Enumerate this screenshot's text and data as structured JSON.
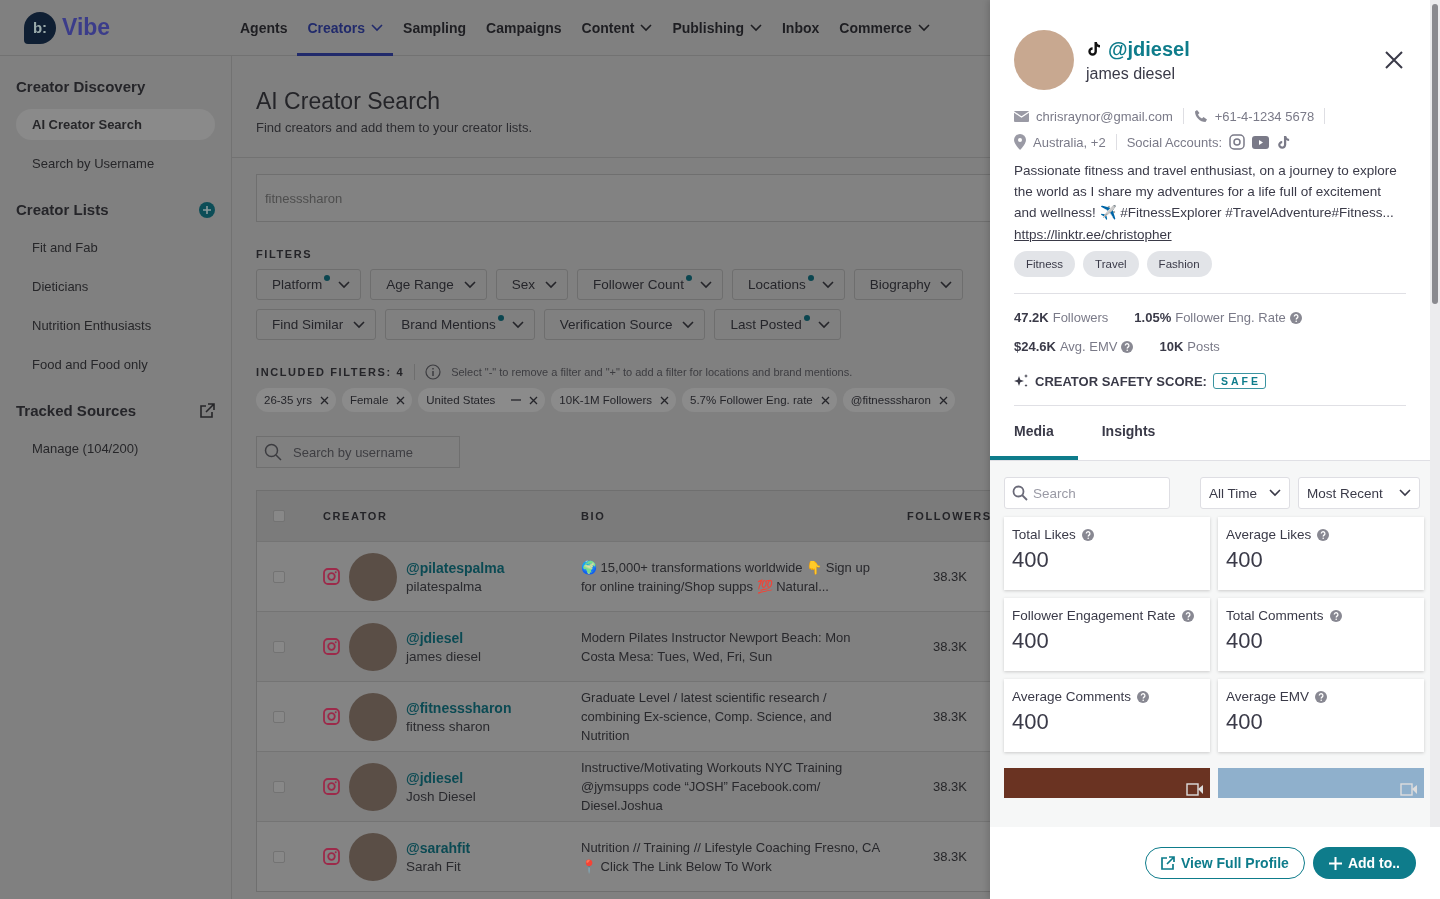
{
  "header": {
    "logo": {
      "mark": "b:",
      "name": "Vibe"
    },
    "nav": [
      {
        "label": "Agents",
        "dropdown": false,
        "selected": false
      },
      {
        "label": "Creators",
        "dropdown": true,
        "selected": true
      },
      {
        "label": "Sampling",
        "dropdown": false,
        "selected": false
      },
      {
        "label": "Campaigns",
        "dropdown": false,
        "selected": false
      },
      {
        "label": "Content",
        "dropdown": true,
        "selected": false
      },
      {
        "label": "Publishing",
        "dropdown": true,
        "selected": false
      },
      {
        "label": "Inbox",
        "dropdown": false,
        "selected": false
      },
      {
        "label": "Commerce",
        "dropdown": true,
        "selected": false
      }
    ]
  },
  "sidebar": {
    "sections": [
      {
        "title": "Creator Discovery",
        "kind": "plain",
        "items": [
          {
            "label": "AI Creator Search",
            "selected": true
          },
          {
            "label": "Search by Username",
            "selected": false
          }
        ]
      },
      {
        "title": "Creator Lists",
        "kind": "add",
        "items": [
          {
            "label": "Fit and Fab",
            "selected": false
          },
          {
            "label": "Dieticians",
            "selected": false
          },
          {
            "label": "Nutrition Enthusiasts",
            "selected": false
          },
          {
            "label": "Food and Food only",
            "selected": false
          }
        ]
      },
      {
        "title": "Tracked Sources",
        "kind": "external",
        "items": [
          {
            "label": "Manage (104/200)",
            "selected": false
          }
        ]
      }
    ]
  },
  "main": {
    "title": "AI Creator Search",
    "subtitle": "Find creators and add them to your creator lists.",
    "search": {
      "placeholder": "fitnesssharon"
    },
    "filters": {
      "label": "FILTERS",
      "items": [
        {
          "label": "Platform",
          "active": true
        },
        {
          "label": "Age Range",
          "active": false
        },
        {
          "label": "Sex",
          "active": false
        },
        {
          "label": "Follower Count",
          "active": true
        },
        {
          "label": "Locations",
          "active": true
        },
        {
          "label": "Biography",
          "active": false
        },
        {
          "label": "Find Similar",
          "active": false
        },
        {
          "label": "Brand Mentions",
          "active": true
        },
        {
          "label": "Verification Source",
          "active": false
        },
        {
          "label": "Last Posted",
          "active": true
        }
      ]
    },
    "included": {
      "label": "INCLUDED FILTERS: 4",
      "hint": "Select \"-\" to remove a filter and \"+\" to add a filter for locations and brand mentions.",
      "chips": [
        {
          "label": "26-35 yrs",
          "kind": "plain"
        },
        {
          "label": "Female",
          "kind": "plain"
        },
        {
          "label": "United States",
          "kind": "toggle"
        },
        {
          "label": "10K-1M Followers",
          "kind": "plain"
        },
        {
          "label": "5.7% Follower Eng. rate",
          "kind": "plain"
        },
        {
          "label": "@fitnesssharon",
          "kind": "plain"
        }
      ]
    },
    "username_search": {
      "placeholder": "Search by username"
    },
    "table": {
      "select_all": {
        "checked": false
      },
      "columns": [
        "CREATOR",
        "BIO",
        "FOLLOWERS"
      ],
      "rows": [
        {
          "checked": false,
          "handle": "@pilatespalma",
          "name": "pilatespalma",
          "bio": "🌍 15,000+ transformations worldwide 👇 Sign up for online training/Shop supps 💯 Natural...",
          "followers": "38.3K"
        },
        {
          "checked": false,
          "handle": "@jdiesel",
          "name": "james diesel",
          "bio": "Modern Pilates Instructor Newport Beach: Mon Costa Mesa: Tues, Wed, Fri, Sun",
          "followers": "38.3K"
        },
        {
          "checked": false,
          "handle": "@fitnesssharon",
          "name": "fitness sharon",
          "bio": "Graduate Level / latest scientific research / combining Ex-science, Comp. Science, and Nutrition",
          "followers": "38.3K"
        },
        {
          "checked": false,
          "handle": "@jdiesel",
          "name": "Josh Diesel",
          "bio": "Instructive/Motivating Workouts NYC Training @jymsupps code “JOSH” Facebook.com/ Diesel.Joshua",
          "followers": "38.3K"
        },
        {
          "checked": false,
          "handle": "@sarahfit",
          "name": "Sarah Fit",
          "bio": "Nutrition // Training // Lifestyle Coaching Fresno, CA📍 Click The Link Below To Work",
          "followers": "38.3K"
        }
      ]
    }
  },
  "drawer": {
    "handle": "@jdiesel",
    "name": "james diesel",
    "email": "chrisraynor@gmail.com",
    "phone": "+61-4-1234 5678",
    "location": "Australia, +2",
    "social_label": "Social Accounts:",
    "bio": "Passionate fitness and travel enthusiast, on a journey to explore the world as I share my adventures for a life full of excitement and wellness! ✈️ #FitnessExplorer #TravelAdventure#Fitness...",
    "link": "https://linktr.ee/christopher",
    "tags": [
      "Fitness",
      "Travel",
      "Fashion"
    ],
    "stats": [
      {
        "value": "47.2K",
        "label": "Followers",
        "help": false
      },
      {
        "value": "1.05%",
        "label": "Follower Eng. Rate",
        "help": true
      },
      {
        "value": "$24.6K",
        "label": "Avg. EMV",
        "help": true
      },
      {
        "value": "10K",
        "label": "Posts",
        "help": false
      }
    ],
    "safety": {
      "label": "CREATOR SAFETY SCORE:",
      "score": "SAFE"
    },
    "tabs": [
      {
        "label": "Media",
        "selected": true
      },
      {
        "label": "Insights",
        "selected": false
      }
    ],
    "media_search": {
      "placeholder": "Search"
    },
    "period": "All Time",
    "sort": "Most Recent",
    "metrics": [
      {
        "label": "Total Likes",
        "value": "400"
      },
      {
        "label": "Average Likes",
        "value": "400"
      },
      {
        "label": "Follower Engagement Rate",
        "value": "400"
      },
      {
        "label": "Total Comments",
        "value": "400"
      },
      {
        "label": "Average Comments",
        "value": "400"
      },
      {
        "label": "Average EMV",
        "value": "400"
      }
    ],
    "buttons": {
      "secondary": "View Full Profile",
      "primary": "Add to.."
    }
  }
}
